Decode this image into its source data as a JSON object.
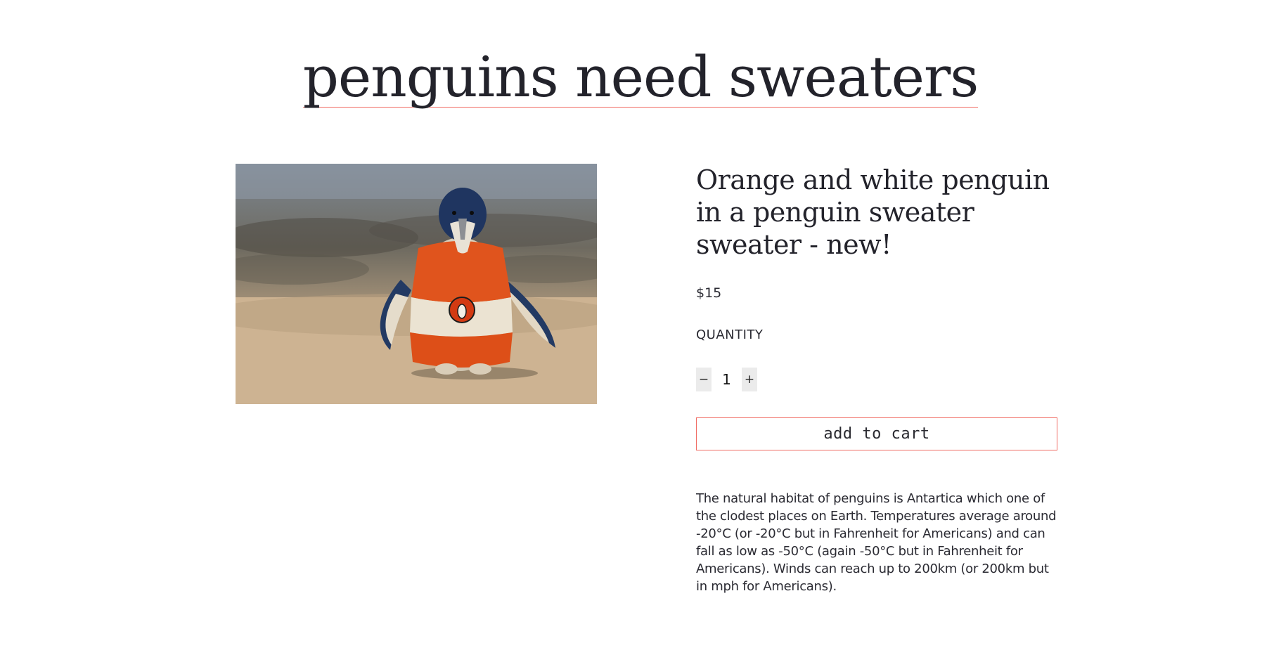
{
  "site": {
    "title": "penguins need sweaters"
  },
  "product": {
    "image_alt": "Orange and white penguin in a penguin sweater sweater",
    "title": "Orange and white penguin in a penguin sweater sweater - new!",
    "price": "$15",
    "quantity_label": "QUANTITY",
    "quantity": "1",
    "decrement_label": "−",
    "increment_label": "+",
    "add_to_cart_label": "add to cart",
    "description": "The natural habitat of penguins is Antartica which one of the clodest places on Earth. Temperatures average around -20°C (or -20°C but in Fahrenheit for Americans) and can fall as low as -50°C (again -50°C but in Fahrenheit for Americans). Winds can reach up to 200km (or 200km but in mph for Americans)."
  },
  "colors": {
    "accent": "#f06b63",
    "text": "#23232b",
    "stepper_bg": "#ebebeb"
  }
}
